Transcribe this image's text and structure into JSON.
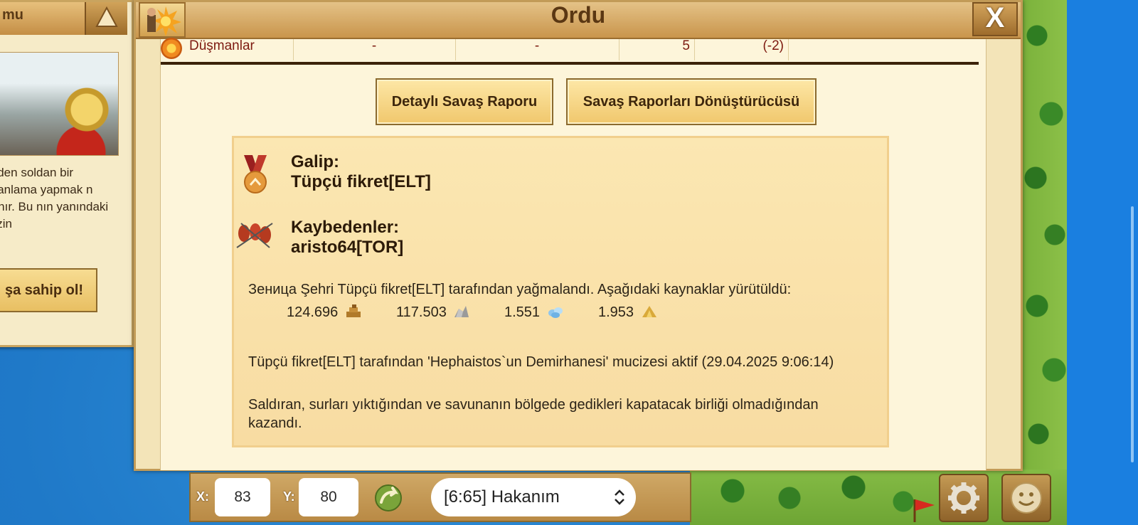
{
  "quest": {
    "title": "mu",
    "text": "niden soldan bir planlama yapmak n tanır. Bu nın yanındaki sizin",
    "button_label": "şa sahip ol!"
  },
  "window": {
    "title": "Ordu",
    "close_label": "X"
  },
  "enemies_row": {
    "label": "Düşmanlar",
    "col1": "-",
    "col2": "-",
    "col3": "5",
    "col4": "(-2)"
  },
  "buttons": {
    "detail_report": "Detaylı Savaş Raporu",
    "report_converter": "Savaş Raporları Dönüştürücüsü"
  },
  "report": {
    "winner_label": "Galip:",
    "winner_name": "Tüpçü fikret[ELT]",
    "losers_label": "Kaybedenler:",
    "loser_name": "aristo64[TOR]",
    "plunder_text": "Зеница Şehri Tüpçü fikret[ELT] tarafından yağmalandı. Aşağıdaki kaynaklar yürütüldü:",
    "resources": {
      "wood": "124.696",
      "stone": "117.503",
      "silver": "1.551",
      "favor": "1.953"
    },
    "wonder_text": "Tüpçü fikret[ELT] tarafından 'Hephaistos`un Demirhanesi' mucizesi aktif (29.04.2025 9:06:14)",
    "result_text": "Saldıran, surları yıktığından ve savunanın bölgede gedikleri kapatacak birliği olmadığından kazandı."
  },
  "coords": {
    "x_label": "X:",
    "x_value": "83",
    "y_label": "Y:",
    "y_value": "80"
  },
  "town_select": {
    "selected": "[6:65] Hakanım"
  },
  "colors": {
    "window_bg": "#f3e4b8",
    "title_text": "#5a3713",
    "enemy_text": "#7d1a10"
  }
}
